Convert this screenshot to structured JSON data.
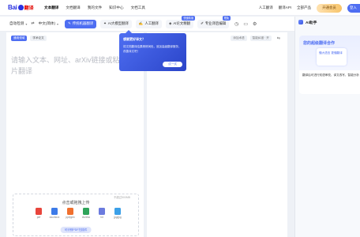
{
  "nav": {
    "logo_text": "Bai",
    "logo_text2": "翻译",
    "items": [
      "文本翻译",
      "文档翻译",
      "我的文件",
      "知识中心",
      "文档工具"
    ],
    "right_items": [
      "人工翻译",
      "翻译API",
      "全部产品"
    ],
    "vip": "开通会员",
    "login": "登入"
  },
  "toolbar": {
    "source_lang": "自动检测",
    "target_lang": "中文(简体)",
    "modes": [
      {
        "label": "传统机器翻译",
        "icon": "✎",
        "badge": ""
      },
      {
        "label": "AI大模型翻译",
        "icon": "✦",
        "badge": ""
      },
      {
        "label": "人工翻译",
        "icon": "✍",
        "badge": ""
      },
      {
        "label": "AI论文精翻",
        "icon": "◈",
        "badge": "快速精读"
      },
      {
        "label": "专业译后编辑",
        "icon": "✐",
        "badge": "限免"
      }
    ]
  },
  "left": {
    "chip_domain": "通用领域",
    "chip_style": "学术论文",
    "placeholder": "请输入文本、网址、arXiv链接或粘贴图片翻译",
    "upload_hint": "不超过500MB",
    "upload_title": "点击或拖拽上传",
    "files": [
      {
        "label": "pdf",
        "color": "#e8453c"
      },
      {
        "label": "doc/docx",
        "color": "#3d7be8"
      },
      {
        "label": "ppt/pptx",
        "color": "#f0702e"
      },
      {
        "label": "xls/xlsx",
        "color": "#2fa45a"
      },
      {
        "label": "txt",
        "color": "#6b7bde"
      },
      {
        "label": "jpg/jpg",
        "color": "#3ba0e8"
      }
    ],
    "upload_btn": "可识别PDF扫描件"
  },
  "right": {
    "chips": [
      "添加术语",
      "智能纠错 · 开"
    ],
    "clear": "⇆"
  },
  "popup": {
    "title": "想要更好译文？",
    "body": "将文档翻译结果精修润色，追加高级翻译服务，改善译文吧！",
    "button": "试一试"
  },
  "ai": {
    "title": "AI助手",
    "card_title": "您的超级翻译合作",
    "illus_text": "懂大语言 更懂翻译",
    "card_text": "翻译后可进行双语审校、译文改写、智能分析"
  }
}
